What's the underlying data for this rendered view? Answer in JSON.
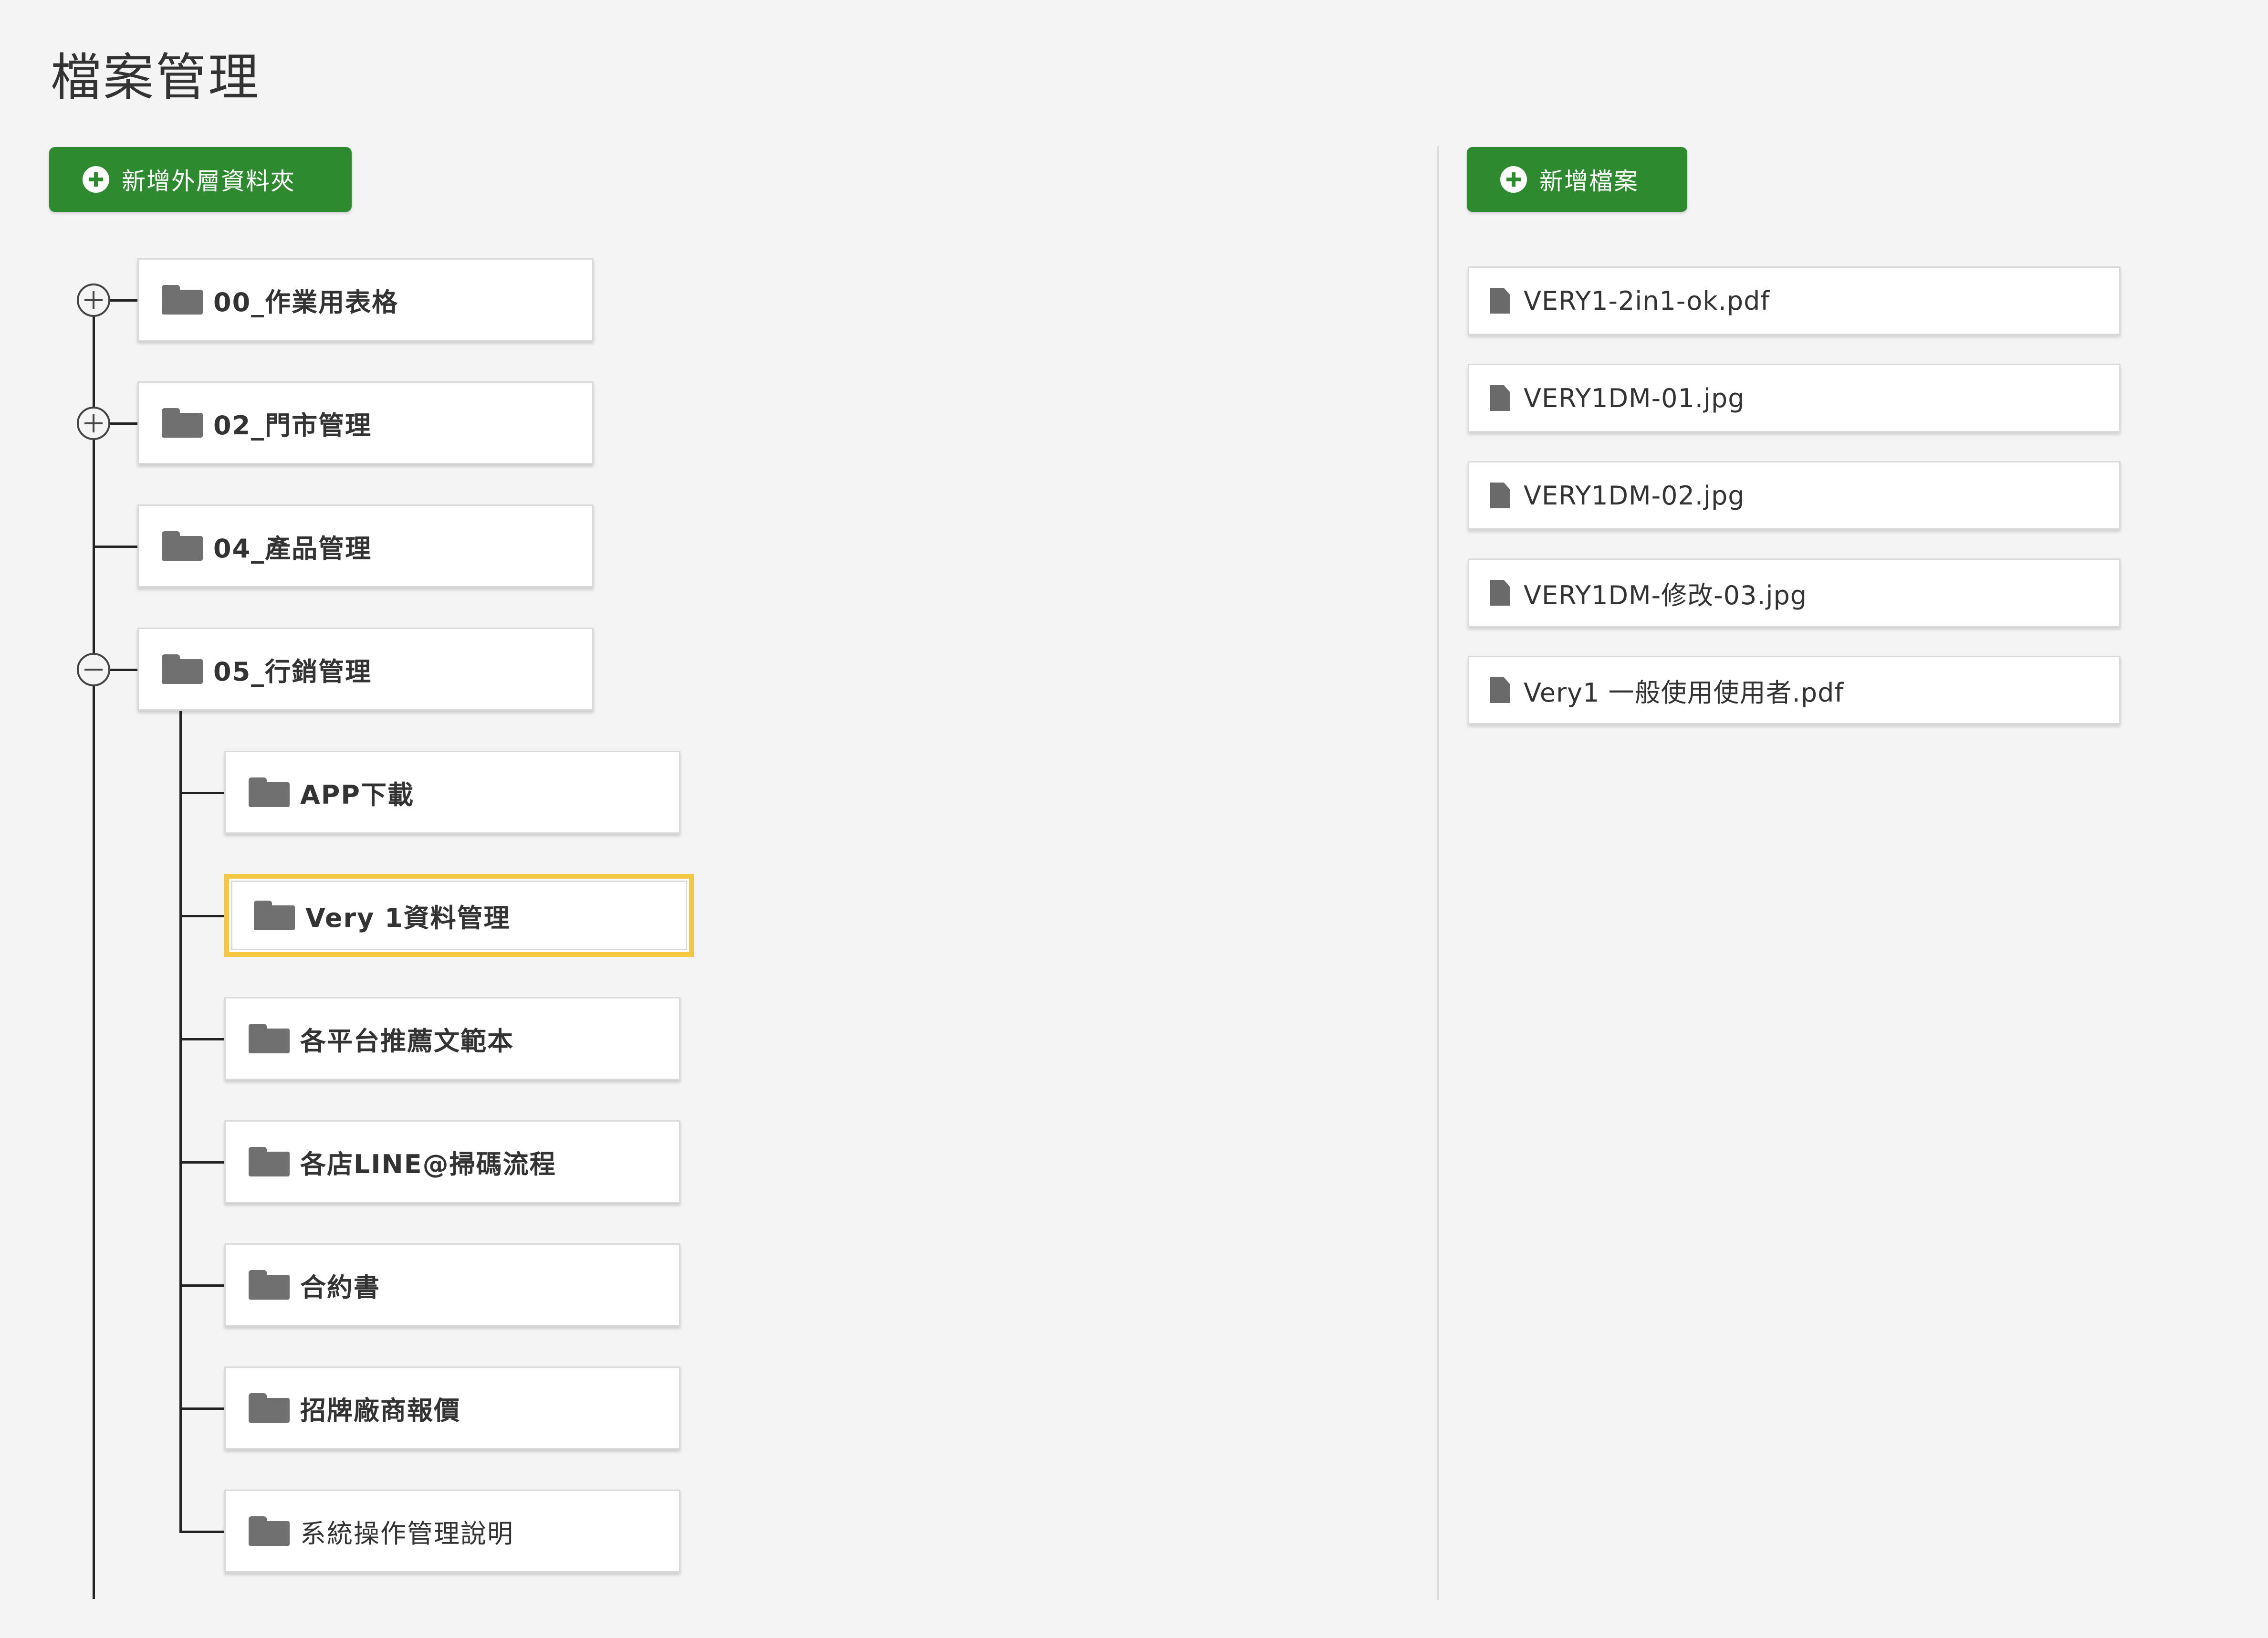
{
  "page": {
    "title": "檔案管理"
  },
  "toolbar": {
    "add_folder_label": "新增外層資料夾",
    "add_file_label": "新增檔案"
  },
  "colors": {
    "primary_button": "#2e8a2e",
    "selected_border": "#f5c842",
    "folder_icon": "#707070",
    "background": "#f4f4f4"
  },
  "tree": {
    "top_level": [
      {
        "label": "00_作業用表格",
        "toggle": "plus"
      },
      {
        "label": "02_門市管理",
        "toggle": "plus"
      },
      {
        "label": "04_產品管理",
        "toggle": "none"
      },
      {
        "label": "05_行銷管理",
        "toggle": "minus"
      }
    ],
    "children": [
      {
        "label": "APP下載",
        "selected": false
      },
      {
        "label": "Very 1資料管理",
        "selected": true
      },
      {
        "label": "各平台推薦文範本",
        "selected": false
      },
      {
        "label": "各店LINE@掃碼流程",
        "selected": false
      },
      {
        "label": "合約書",
        "selected": false
      },
      {
        "label": "招牌廠商報價",
        "selected": false
      },
      {
        "label": "系統操作管理說明",
        "selected": false
      }
    ]
  },
  "files": [
    {
      "name": "VERY1-2in1-ok.pdf",
      "icon": "file-icon"
    },
    {
      "name": "VERY1DM-01.jpg",
      "icon": "file-icon"
    },
    {
      "name": "VERY1DM-02.jpg",
      "icon": "file-icon"
    },
    {
      "name": "VERY1DM-修改-03.jpg",
      "icon": "file-icon"
    },
    {
      "name": "Very1 一般使用使用者.pdf",
      "icon": "file-icon"
    }
  ]
}
